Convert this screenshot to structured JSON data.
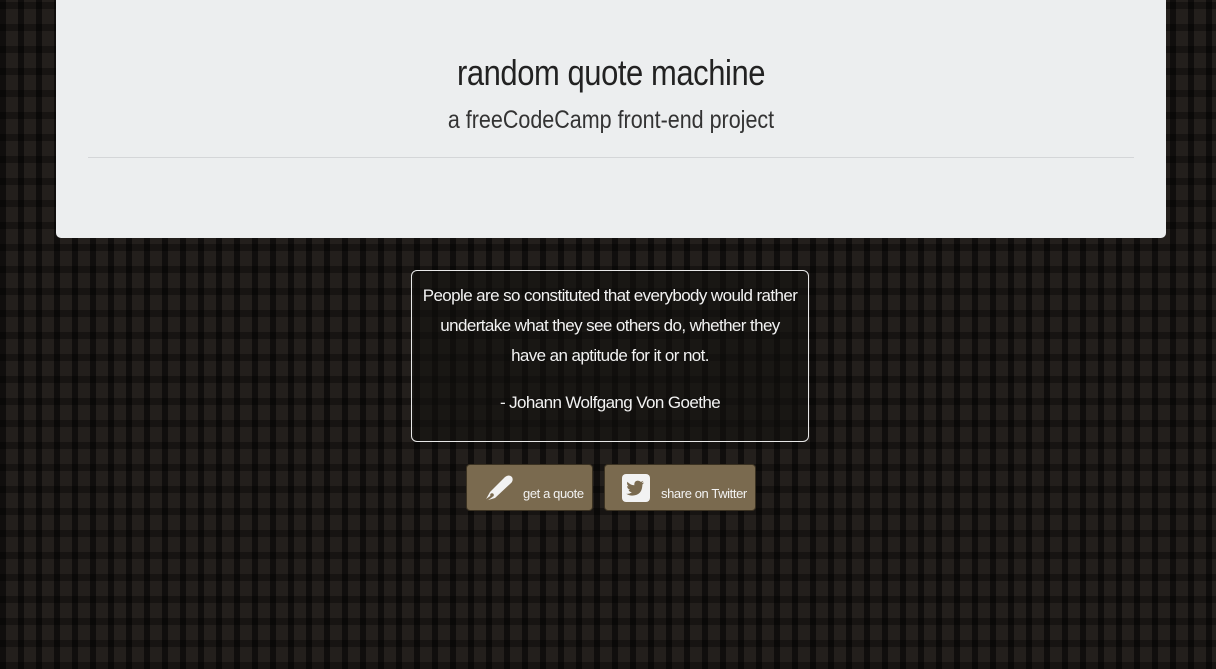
{
  "header": {
    "title": "random quote machine",
    "subtitle": "a freeCodeCamp front-end project"
  },
  "quote": {
    "text": "People are so constituted that everybody would rather undertake what they see others do, whether they have an aptitude for it or not.",
    "author": "- Johann Wolfgang Von Goethe"
  },
  "buttons": {
    "get_quote": {
      "label": "get a quote",
      "icon": "pen-icon"
    },
    "tweet": {
      "label": "share on Twitter",
      "icon": "twitter-square-icon"
    }
  },
  "colors": {
    "header_bg": "#eceeef",
    "page_bg": "#231f1c",
    "button_bg": "#7a6a4f",
    "quote_border": "#e8e8e8"
  }
}
